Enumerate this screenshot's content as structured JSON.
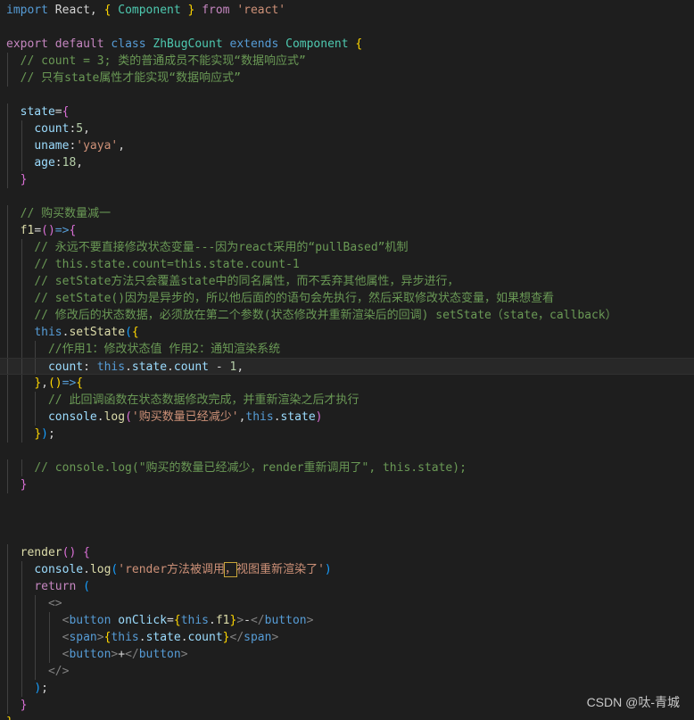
{
  "editor": {
    "lines": [
      [
        [
          "kw",
          "import"
        ],
        [
          "pun",
          " React, "
        ],
        [
          "br1",
          "{"
        ],
        [
          "pun",
          " "
        ],
        [
          "cls",
          "Component"
        ],
        [
          "pun",
          " "
        ],
        [
          "br1",
          "}"
        ],
        [
          "pun",
          " "
        ],
        [
          "ctl",
          "from"
        ],
        [
          "pun",
          " "
        ],
        [
          "str",
          "'react'"
        ]
      ],
      [],
      [
        [
          "ctl",
          "export"
        ],
        [
          "pun",
          " "
        ],
        [
          "ctl",
          "default"
        ],
        [
          "pun",
          " "
        ],
        [
          "kw",
          "class"
        ],
        [
          "pun",
          " "
        ],
        [
          "cls",
          "ZhBugCount"
        ],
        [
          "pun",
          " "
        ],
        [
          "kw",
          "extends"
        ],
        [
          "pun",
          " "
        ],
        [
          "cls",
          "Component"
        ],
        [
          "pun",
          " "
        ],
        [
          "br1",
          "{"
        ]
      ],
      [
        [
          "pun",
          "  "
        ],
        [
          "cmt",
          "// count = 3; 类的普通成员不能实现“数据响应式”"
        ]
      ],
      [
        [
          "pun",
          "  "
        ],
        [
          "cmt",
          "// 只有state属性才能实现“数据响应式”"
        ]
      ],
      [],
      [
        [
          "pun",
          "  "
        ],
        [
          "var",
          "state"
        ],
        [
          "pun",
          "="
        ],
        [
          "br2",
          "{"
        ]
      ],
      [
        [
          "pun",
          "    "
        ],
        [
          "var",
          "count"
        ],
        [
          "pun",
          ":"
        ],
        [
          "num",
          "5"
        ],
        [
          "pun",
          ","
        ]
      ],
      [
        [
          "pun",
          "    "
        ],
        [
          "var",
          "uname"
        ],
        [
          "pun",
          ":"
        ],
        [
          "str",
          "'yaya'"
        ],
        [
          "pun",
          ","
        ]
      ],
      [
        [
          "pun",
          "    "
        ],
        [
          "var",
          "age"
        ],
        [
          "pun",
          ":"
        ],
        [
          "num",
          "18"
        ],
        [
          "pun",
          ","
        ]
      ],
      [
        [
          "pun",
          "  "
        ],
        [
          "br2",
          "}"
        ]
      ],
      [],
      [
        [
          "pun",
          "  "
        ],
        [
          "cmt",
          "// 购买数量减一"
        ]
      ],
      [
        [
          "pun",
          "  "
        ],
        [
          "fn",
          "f1"
        ],
        [
          "pun",
          "="
        ],
        [
          "br2",
          "("
        ],
        [
          "br2",
          ")"
        ],
        [
          "kw",
          "=>"
        ],
        [
          "br2",
          "{"
        ]
      ],
      [
        [
          "pun",
          "    "
        ],
        [
          "cmt",
          "// 永远不要直接修改状态变量---因为react采用的“pullBased”机制"
        ]
      ],
      [
        [
          "pun",
          "    "
        ],
        [
          "cmt",
          "// this.state.count=this.state.count-1"
        ]
      ],
      [
        [
          "pun",
          "    "
        ],
        [
          "cmt",
          "// setState方法只会覆盖state中的同名属性，而不丢弃其他属性，异步进行，"
        ]
      ],
      [
        [
          "pun",
          "    "
        ],
        [
          "cmt",
          "// setState()因为是异步的，所以他后面的的语句会先执行，然后采取修改状态变量，如果想查看"
        ]
      ],
      [
        [
          "pun",
          "    "
        ],
        [
          "cmt",
          "// 修改后的状态数据，必须放在第二个参数(状态修改并重新渲染后的回调) setState（state，callback）"
        ]
      ],
      [
        [
          "pun",
          "    "
        ],
        [
          "kw",
          "this"
        ],
        [
          "pun",
          "."
        ],
        [
          "fn",
          "setState"
        ],
        [
          "br3",
          "("
        ],
        [
          "br1",
          "{"
        ]
      ],
      [
        [
          "pun",
          "      "
        ],
        [
          "cmt",
          "//作用1：修改状态值 作用2：通知渲染系统"
        ]
      ],
      [
        [
          "pun",
          "      "
        ],
        [
          "var",
          "count"
        ],
        [
          "pun",
          ": "
        ],
        [
          "kw",
          "this"
        ],
        [
          "pun",
          "."
        ],
        [
          "var",
          "state"
        ],
        [
          "pun",
          "."
        ],
        [
          "var",
          "count"
        ],
        [
          "pun",
          " - "
        ],
        [
          "num",
          "1"
        ],
        [
          "pun",
          ","
        ]
      ],
      [
        [
          "pun",
          "    "
        ],
        [
          "br1",
          "}"
        ],
        [
          "pun",
          ","
        ],
        [
          "br1",
          "("
        ],
        [
          "br1",
          ")"
        ],
        [
          "kw",
          "=>"
        ],
        [
          "br1",
          "{"
        ]
      ],
      [
        [
          "pun",
          "      "
        ],
        [
          "cmt",
          "// 此回调函数在状态数据修改完成，并重新渲染之后才执行"
        ]
      ],
      [
        [
          "pun",
          "      "
        ],
        [
          "var",
          "console"
        ],
        [
          "pun",
          "."
        ],
        [
          "fn",
          "log"
        ],
        [
          "br2",
          "("
        ],
        [
          "str",
          "'购买数量已经减少'"
        ],
        [
          "pun",
          ","
        ],
        [
          "kw",
          "this"
        ],
        [
          "pun",
          "."
        ],
        [
          "var",
          "state"
        ],
        [
          "br2",
          ")"
        ]
      ],
      [
        [
          "pun",
          "    "
        ],
        [
          "br1",
          "}"
        ],
        [
          "br3",
          ")"
        ],
        [
          "pun",
          ";"
        ]
      ],
      [],
      [
        [
          "pun",
          "    "
        ],
        [
          "cmt",
          "// console.log(\"购买的数量已经减少，render重新调用了\", this.state);"
        ]
      ],
      [
        [
          "pun",
          "  "
        ],
        [
          "br2",
          "}"
        ]
      ],
      [],
      [],
      [],
      [
        [
          "pun",
          "  "
        ],
        [
          "fn",
          "render"
        ],
        [
          "br2",
          "("
        ],
        [
          "br2",
          ")"
        ],
        [
          "pun",
          " "
        ],
        [
          "br2",
          "{"
        ]
      ],
      [
        [
          "pun",
          "    "
        ],
        [
          "var",
          "console"
        ],
        [
          "pun",
          "."
        ],
        [
          "fn",
          "log"
        ],
        [
          "br3",
          "("
        ],
        [
          "str",
          "'render方法被调用"
        ],
        [
          "str",
          "，",
          "hl"
        ],
        [
          "str",
          "视图重新渲染了'"
        ],
        [
          "br3",
          ")"
        ]
      ],
      [
        [
          "pun",
          "    "
        ],
        [
          "ctl",
          "return"
        ],
        [
          "pun",
          " "
        ],
        [
          "br3",
          "("
        ]
      ],
      [
        [
          "pun",
          "      "
        ],
        [
          "tagp",
          "<>"
        ]
      ],
      [
        [
          "pun",
          "        "
        ],
        [
          "tagp",
          "<"
        ],
        [
          "tag",
          "button"
        ],
        [
          "pun",
          " "
        ],
        [
          "attr",
          "onClick"
        ],
        [
          "pun",
          "="
        ],
        [
          "br1",
          "{"
        ],
        [
          "kw",
          "this"
        ],
        [
          "pun",
          "."
        ],
        [
          "fn",
          "f1"
        ],
        [
          "br1",
          "}"
        ],
        [
          "tagp",
          ">"
        ],
        [
          "pun",
          "-"
        ],
        [
          "tagp",
          "</"
        ],
        [
          "tag",
          "button"
        ],
        [
          "tagp",
          ">"
        ]
      ],
      [
        [
          "pun",
          "        "
        ],
        [
          "tagp",
          "<"
        ],
        [
          "tag",
          "span"
        ],
        [
          "tagp",
          ">"
        ],
        [
          "br1",
          "{"
        ],
        [
          "kw",
          "this"
        ],
        [
          "pun",
          "."
        ],
        [
          "var",
          "state"
        ],
        [
          "pun",
          "."
        ],
        [
          "var",
          "count"
        ],
        [
          "br1",
          "}"
        ],
        [
          "tagp",
          "</"
        ],
        [
          "tag",
          "span"
        ],
        [
          "tagp",
          ">"
        ]
      ],
      [
        [
          "pun",
          "        "
        ],
        [
          "tagp",
          "<"
        ],
        [
          "tag",
          "button"
        ],
        [
          "tagp",
          ">"
        ],
        [
          "pun",
          "+"
        ],
        [
          "tagp",
          "</"
        ],
        [
          "tag",
          "button"
        ],
        [
          "tagp",
          ">"
        ]
      ],
      [
        [
          "pun",
          "      "
        ],
        [
          "tagp",
          "</>"
        ]
      ],
      [
        [
          "pun",
          "    "
        ],
        [
          "br3",
          ")"
        ],
        [
          "pun",
          ";"
        ]
      ],
      [
        [
          "pun",
          "  "
        ],
        [
          "br2",
          "}"
        ]
      ],
      [
        [
          "br1",
          "}"
        ]
      ]
    ],
    "current_line": 22
  },
  "watermark": "CSDN @呔-青城"
}
